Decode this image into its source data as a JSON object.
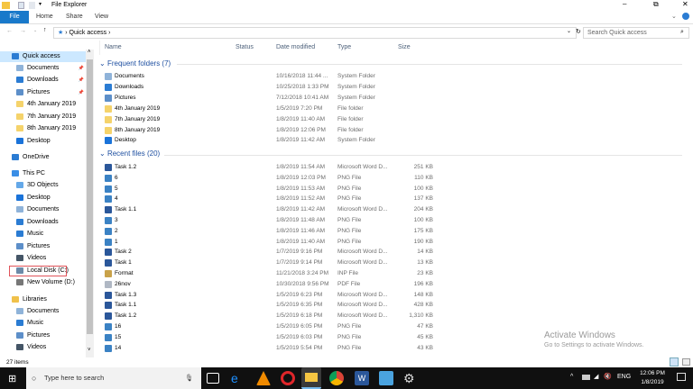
{
  "window": {
    "title": "File Explorer"
  },
  "ribbon": {
    "tabs": [
      "File",
      "Home",
      "Share",
      "View"
    ]
  },
  "address": {
    "path": "Quick access",
    "search_placeholder": "Search Quick access"
  },
  "columns": {
    "name": "Name",
    "status": "Status",
    "date": "Date modified",
    "type": "Type",
    "size": "Size"
  },
  "sidebar": {
    "items": [
      {
        "label": "Quick access",
        "icon": "star-icon",
        "color": "#2b7cd3"
      },
      {
        "label": "Documents",
        "icon": "documents-icon",
        "color": "#8fb3d9"
      },
      {
        "label": "Downloads",
        "icon": "download-icon",
        "color": "#2b7cd3"
      },
      {
        "label": "Pictures",
        "icon": "pictures-icon",
        "color": "#5d8fc9"
      },
      {
        "label": "4th January 2019",
        "icon": "folder-icon",
        "color": "#f5d36b"
      },
      {
        "label": "7th January 2019",
        "icon": "folder-icon",
        "color": "#f5d36b"
      },
      {
        "label": "8th January 2019",
        "icon": "folder-icon",
        "color": "#f5d36b"
      },
      {
        "label": "Desktop",
        "icon": "desktop-icon",
        "color": "#1a73d9"
      },
      {
        "label": "OneDrive",
        "icon": "cloud-icon",
        "color": "#2b7cd3"
      },
      {
        "label": "This PC",
        "icon": "pc-icon",
        "color": "#3a8ee6"
      },
      {
        "label": "3D Objects",
        "icon": "cube-icon",
        "color": "#64a8e8"
      },
      {
        "label": "Desktop",
        "icon": "desktop-icon",
        "color": "#1a73d9"
      },
      {
        "label": "Documents",
        "icon": "documents-icon",
        "color": "#8fb3d9"
      },
      {
        "label": "Downloads",
        "icon": "download-icon",
        "color": "#2b7cd3"
      },
      {
        "label": "Music",
        "icon": "music-icon",
        "color": "#2b7cd3"
      },
      {
        "label": "Pictures",
        "icon": "pictures-icon",
        "color": "#5d8fc9"
      },
      {
        "label": "Videos",
        "icon": "video-icon",
        "color": "#445566"
      },
      {
        "label": "Local Disk (C:)",
        "icon": "drive-icon",
        "color": "#6c8aa8"
      },
      {
        "label": "New Volume (D:)",
        "icon": "drive-icon",
        "color": "#777777"
      },
      {
        "label": "Libraries",
        "icon": "library-icon",
        "color": "#f0c14b"
      },
      {
        "label": "Documents",
        "icon": "documents-icon",
        "color": "#8fb3d9"
      },
      {
        "label": "Music",
        "icon": "music-icon",
        "color": "#2b7cd3"
      },
      {
        "label": "Pictures",
        "icon": "pictures-icon",
        "color": "#5d8fc9"
      },
      {
        "label": "Videos",
        "icon": "video-icon",
        "color": "#445566"
      }
    ]
  },
  "frequent": {
    "title": "Frequent folders (7)",
    "items": [
      {
        "name": "Documents",
        "date": "10/16/2018 11:44 ...",
        "type": "System Folder",
        "size": "",
        "color": "#8fb3d9"
      },
      {
        "name": "Downloads",
        "date": "10/25/2018 1:33 PM",
        "type": "System Folder",
        "size": "",
        "color": "#2b7cd3"
      },
      {
        "name": "Pictures",
        "date": "7/12/2018 10:41 AM",
        "type": "System Folder",
        "size": "",
        "color": "#5d8fc9"
      },
      {
        "name": "4th January 2019",
        "date": "1/5/2019 7:20 PM",
        "type": "File folder",
        "size": "",
        "color": "#f5d36b"
      },
      {
        "name": "7th January 2019",
        "date": "1/8/2019 11:40 AM",
        "type": "File folder",
        "size": "",
        "color": "#f5d36b"
      },
      {
        "name": "8th January 2019",
        "date": "1/8/2019 12:06 PM",
        "type": "File folder",
        "size": "",
        "color": "#f5d36b"
      },
      {
        "name": "Desktop",
        "date": "1/8/2019 11:42 AM",
        "type": "System Folder",
        "size": "",
        "color": "#1a73d9"
      }
    ]
  },
  "recent": {
    "title": "Recent files (20)",
    "items": [
      {
        "name": "Task 1.2",
        "date": "1/8/2019 11:54 AM",
        "type": "Microsoft Word D...",
        "size": "251 KB",
        "color": "#2b579a"
      },
      {
        "name": "6",
        "date": "1/8/2019 12:03 PM",
        "type": "PNG File",
        "size": "110 KB",
        "color": "#3b82c4"
      },
      {
        "name": "5",
        "date": "1/8/2019 11:53 AM",
        "type": "PNG File",
        "size": "100 KB",
        "color": "#3b82c4"
      },
      {
        "name": "4",
        "date": "1/8/2019 11:52 AM",
        "type": "PNG File",
        "size": "137 KB",
        "color": "#3b82c4"
      },
      {
        "name": "Task 1.1",
        "date": "1/8/2019 11:42 AM",
        "type": "Microsoft Word D...",
        "size": "204 KB",
        "color": "#2b579a"
      },
      {
        "name": "3",
        "date": "1/8/2019 11:48 AM",
        "type": "PNG File",
        "size": "100 KB",
        "color": "#3b82c4"
      },
      {
        "name": "2",
        "date": "1/8/2019 11:46 AM",
        "type": "PNG File",
        "size": "175 KB",
        "color": "#3b82c4"
      },
      {
        "name": "1",
        "date": "1/8/2019 11:40 AM",
        "type": "PNG File",
        "size": "190 KB",
        "color": "#3b82c4"
      },
      {
        "name": "Task 2",
        "date": "1/7/2019 9:16 PM",
        "type": "Microsoft Word D...",
        "size": "14 KB",
        "color": "#2b579a"
      },
      {
        "name": "Task 1",
        "date": "1/7/2019 9:14 PM",
        "type": "Microsoft Word D...",
        "size": "13 KB",
        "color": "#2b579a"
      },
      {
        "name": "Format",
        "date": "11/21/2018 3:24 PM",
        "type": "INP File",
        "size": "23 KB",
        "color": "#c9a24a"
      },
      {
        "name": "26nov",
        "date": "10/30/2018 9:56 PM",
        "type": "PDF File",
        "size": "196 KB",
        "color": "#b0b8c4"
      },
      {
        "name": "Task 1.3",
        "date": "1/5/2019 6:23 PM",
        "type": "Microsoft Word D...",
        "size": "148 KB",
        "color": "#2b579a"
      },
      {
        "name": "Task 1.1",
        "date": "1/5/2019 6:35 PM",
        "type": "Microsoft Word D...",
        "size": "428 KB",
        "color": "#2b579a"
      },
      {
        "name": "Task 1.2",
        "date": "1/5/2019 6:18 PM",
        "type": "Microsoft Word D...",
        "size": "1,310 KB",
        "color": "#2b579a"
      },
      {
        "name": "16",
        "date": "1/5/2019 6:05 PM",
        "type": "PNG File",
        "size": "47 KB",
        "color": "#3b82c4"
      },
      {
        "name": "15",
        "date": "1/5/2019 6:03 PM",
        "type": "PNG File",
        "size": "45 KB",
        "color": "#3b82c4"
      },
      {
        "name": "14",
        "date": "1/5/2019 5:54 PM",
        "type": "PNG File",
        "size": "43 KB",
        "color": "#3b82c4"
      }
    ]
  },
  "status": {
    "count": "27 items"
  },
  "watermark": {
    "line1": "Activate Windows",
    "line2": "Go to Settings to activate Windows."
  },
  "taskbar": {
    "search_placeholder": "Type here to search",
    "lang": "ENG",
    "time": "12:06 PM",
    "date": "1/8/2019"
  }
}
